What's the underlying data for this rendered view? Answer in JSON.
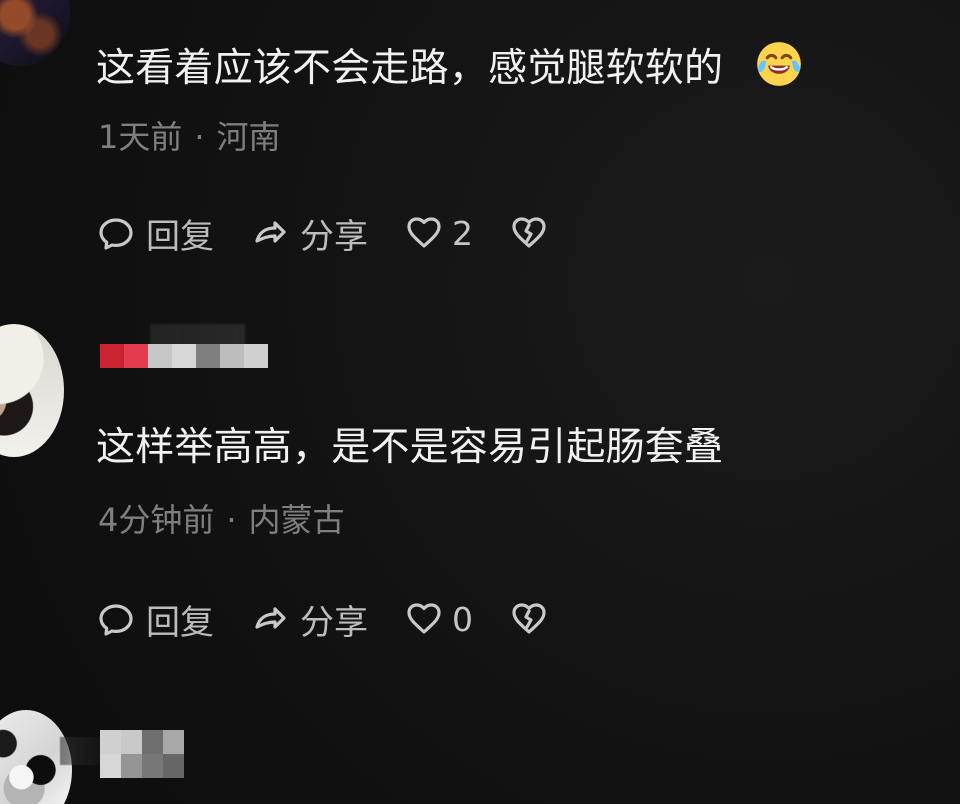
{
  "comments": [
    {
      "text": "这看着应该不会走路，感觉腿软软的",
      "emoji": "laughing-crying-emoji",
      "meta": {
        "time": "1天前",
        "location": "河南"
      },
      "actions": {
        "reply": "回复",
        "share": "分享",
        "like_count": "2"
      },
      "avatar_icon": "avatar-1"
    },
    {
      "text": "这样举高高，是不是容易引起肠套叠",
      "meta": {
        "time": "4分钟前",
        "location": "内蒙古"
      },
      "actions": {
        "reply": "回复",
        "share": "分享",
        "like_count": "0"
      },
      "avatar_icon": "avatar-2"
    },
    {
      "avatar_icon": "avatar-3"
    }
  ],
  "icons": {
    "reply": "comment-bubble-icon",
    "share": "share-arrow-icon",
    "like": "heart-icon",
    "dislike": "broken-heart-icon"
  },
  "colors": {
    "background": "#111111",
    "primary_text": "#f1f1f1",
    "secondary_text": "#7f7f7f",
    "action_text": "#bcbcbc"
  }
}
